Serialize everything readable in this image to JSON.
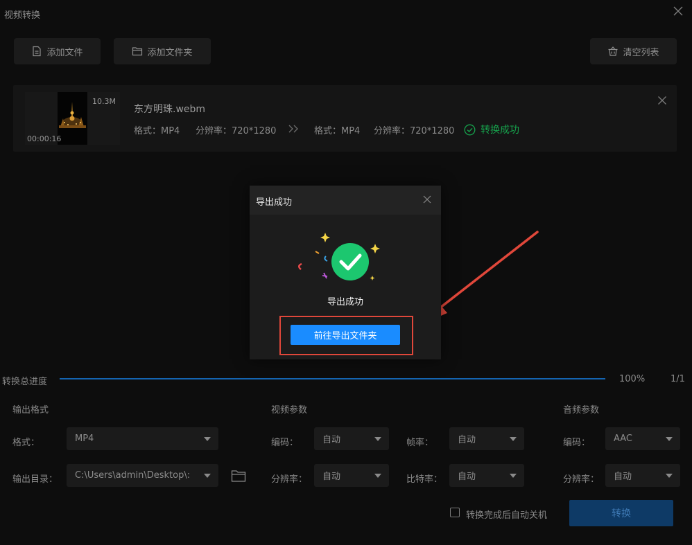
{
  "window": {
    "title": "视频转换"
  },
  "toolbar": {
    "add_file": "添加文件",
    "add_folder": "添加文件夹",
    "clear_list": "清空列表"
  },
  "file": {
    "size": "10.3M",
    "duration": "00:00:16",
    "name": "东方明珠.webm",
    "src_format_label": "格式：MP4",
    "src_res_label": "分辨率：720*1280",
    "dst_format_label": "格式：MP4",
    "dst_res_label": "分辨率：720*1280",
    "status": "转换成功",
    "status_color": "#16a44d"
  },
  "dialog": {
    "title": "导出成功",
    "message": "导出成功",
    "button": "前往导出文件夹",
    "accent": "#1a8cff",
    "highlight_color": "#e0473a"
  },
  "progress": {
    "label": "转换总进度",
    "percent_text": "100%",
    "fraction": 1.0,
    "count": "1/1"
  },
  "output": {
    "section": "输出格式",
    "format_label": "格式：",
    "format_value": "MP4",
    "dir_label": "输出目录：",
    "dir_value": "C:\\Users\\admin\\Desktop\\:"
  },
  "video": {
    "section": "视频参数",
    "codec_label": "编码：",
    "codec_value": "自动",
    "res_label": "分辨率：",
    "res_value": "自动",
    "fps_label": "帧率：",
    "fps_value": "自动",
    "bitrate_label": "比特率：",
    "bitrate_value": "自动"
  },
  "audio": {
    "section": "音频参数",
    "codec_label": "编码：",
    "codec_value": "AAC",
    "res_label": "分辨率：",
    "res_value": "自动"
  },
  "footer": {
    "shutdown_label": "转换完成后自动关机",
    "shutdown_checked": false,
    "convert_button": "转换"
  }
}
